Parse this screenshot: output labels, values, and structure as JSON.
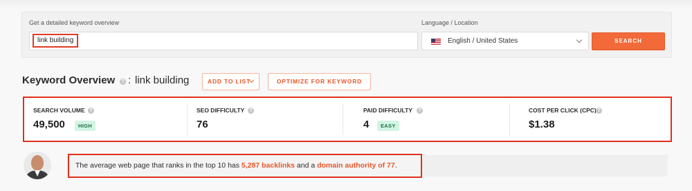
{
  "search": {
    "keyword_label": "Get a detailed keyword overview",
    "keyword_value": "link building",
    "language_label": "Language / Location",
    "language_value": "English / United States",
    "search_button": "SEARCH"
  },
  "overview": {
    "title": "Keyword Overview",
    "info_glyph": "?",
    "colon": ":",
    "keyword": "link building",
    "add_to_list": "ADD TO LIST",
    "optimize": "OPTIMIZE FOR KEYWORD"
  },
  "metrics": [
    {
      "label": "SEARCH VOLUME",
      "value": "49,500",
      "badge": "HIGH"
    },
    {
      "label": "SEO DIFFICULTY",
      "value": "76"
    },
    {
      "label": "PAID DIFFICULTY",
      "value": "4",
      "badge": "EASY"
    },
    {
      "label": "COST PER CLICK (CPC)",
      "value": "$1.38"
    }
  ],
  "insight": {
    "prefix": "The average web page that ranks in the top 10 has ",
    "backlinks": "5,287 backlinks",
    "middle": " and a ",
    "authority": "domain authority of 77",
    "suffix": "."
  },
  "colors": {
    "accent": "#f26a39",
    "highlight_border": "#e02f1d",
    "badge_bg": "#d3f4e3"
  }
}
